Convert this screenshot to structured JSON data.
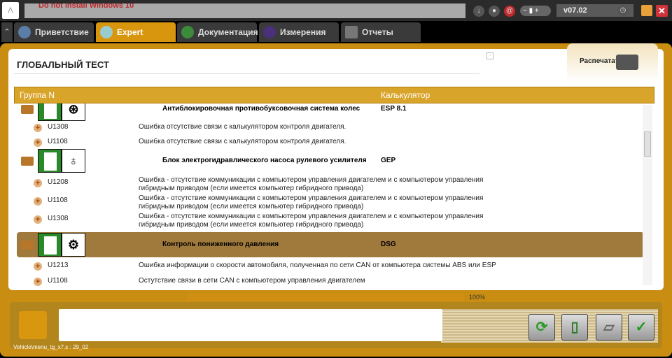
{
  "topbar": {
    "logo": "CITROËN",
    "message": "Do not install Windows 10",
    "version": "v07.02"
  },
  "tabs": [
    {
      "label": "Приветствие"
    },
    {
      "label": "Expert"
    },
    {
      "label": "Документация"
    },
    {
      "label": "Измерения"
    },
    {
      "label": "Отчеты"
    }
  ],
  "page": {
    "title": "ГЛОБАЛЬНЫЙ ТЕСТ",
    "print_label": "Распечатать"
  },
  "table": {
    "headers": [
      "Группа N",
      "Калькулятор"
    ],
    "groups": [
      {
        "name": "Антиблокировочная противобуксовочная система колес",
        "calc": "ESP 8.1",
        "faults": [
          {
            "code": "U1308",
            "desc": "Ошибка отсутствие связи с калькулятором контроля двигателя."
          },
          {
            "code": "U1108",
            "desc": "Ошибка отсутствие связи с калькулятором контроля двигателя."
          }
        ]
      },
      {
        "name": "Блок электрогидравлического насоса рулевого усилителя",
        "calc": "GEP",
        "faults": [
          {
            "code": "U1208",
            "desc": "Ошибка - отсутствие коммуникации с компьютером управления двигателем и с компьютером управления",
            "desc2": "гибридным приводом (если имеется компьютер гибридного привода)"
          },
          {
            "code": "U1108",
            "desc": "Ошибка - отсутствие коммуникации с компьютером управления двигателем и с компьютером управления",
            "desc2": "гибридным приводом (если имеется компьютер гибридного привода)"
          },
          {
            "code": "U1308",
            "desc": "Ошибка - отсутствие коммуникации с компьютером управления двигателем и с компьютером управления",
            "desc2": "гибридным приводом (если имеется компьютер гибридного привода)"
          }
        ]
      },
      {
        "name": "Контроль пониженного давления",
        "calc": "DSG",
        "faults": [
          {
            "code": "U1213",
            "desc": "Ошибка информации о скорости автомобиля, полученная по сети CAN от компьютера системы ABS или ESP"
          },
          {
            "code": "U1108",
            "desc": "Остутствие связи в сети CAN с компьютером управления двигателем"
          }
        ]
      }
    ]
  },
  "progress": {
    "value": 100,
    "label": "100%"
  },
  "footer": {
    "path": "Vehicle\\menu_tg_x7.s : 29_02"
  }
}
